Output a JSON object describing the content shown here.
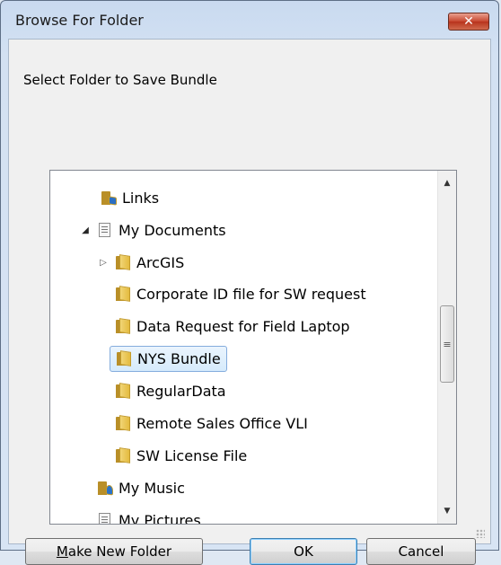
{
  "window": {
    "title": "Browse For Folder",
    "close_symbol": "✕"
  },
  "prompt": "Select Folder to Save Bundle",
  "tree": {
    "items": [
      {
        "label": "Links",
        "icon": "folder-links-icon"
      },
      {
        "label": "My Documents",
        "icon": "documents-icon",
        "expanded": true
      },
      {
        "label": "ArcGIS",
        "icon": "folder-icon",
        "collapsed": true
      },
      {
        "label": "Corporate ID file for SW request",
        "icon": "folder-icon"
      },
      {
        "label": "Data Request for Field Laptop",
        "icon": "folder-icon"
      },
      {
        "label": "NYS Bundle",
        "icon": "folder-icon",
        "selected": true
      },
      {
        "label": "RegularData",
        "icon": "folder-icon"
      },
      {
        "label": "Remote Sales Office VLI",
        "icon": "folder-icon"
      },
      {
        "label": "SW License File",
        "icon": "folder-icon"
      },
      {
        "label": "My Music",
        "icon": "music-folder-icon"
      },
      {
        "label": "My Pictures",
        "icon": "pictures-folder-icon"
      }
    ],
    "expanded_arrow": "◢",
    "collapsed_arrow": "▷"
  },
  "buttons": {
    "make_new_folder_mnemonic": "M",
    "make_new_folder_rest": "ake New Folder",
    "ok": "OK",
    "cancel": "Cancel"
  },
  "scrollbar": {
    "up": "▲",
    "down": "▼",
    "grip": "≡"
  }
}
